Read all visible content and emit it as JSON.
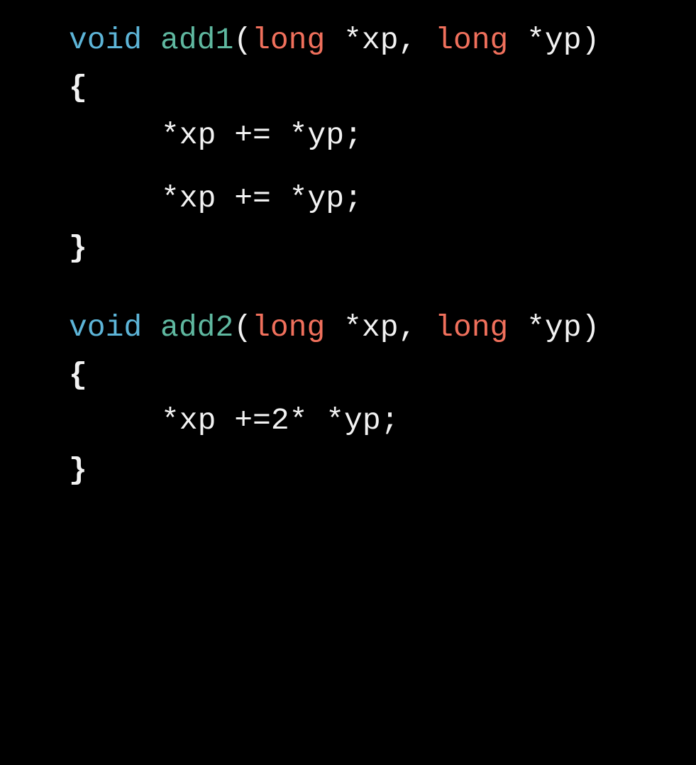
{
  "colors": {
    "background": "#000000",
    "keyword": "#5db5d8",
    "function_name": "#5fb8a0",
    "type": "#f0705c",
    "plain": "#f2f2f2"
  },
  "functions": [
    {
      "keyword": "void",
      "name": "add1",
      "open_paren": "(",
      "param1_type": "long",
      "param1_rest": " *xp, ",
      "param2_type": "long",
      "param2_rest": " *yp)",
      "open_brace": "{",
      "body": [
        "*xp += *yp;",
        "*xp += *yp;"
      ],
      "close_brace": "}"
    },
    {
      "keyword": "void",
      "name": "add2",
      "open_paren": "(",
      "param1_type": "long",
      "param1_rest": " *xp, ",
      "param2_type": "long",
      "param2_rest": " *yp)",
      "open_brace": "{",
      "body": [
        "*xp +=2* *yp;"
      ],
      "close_brace": "}"
    }
  ]
}
